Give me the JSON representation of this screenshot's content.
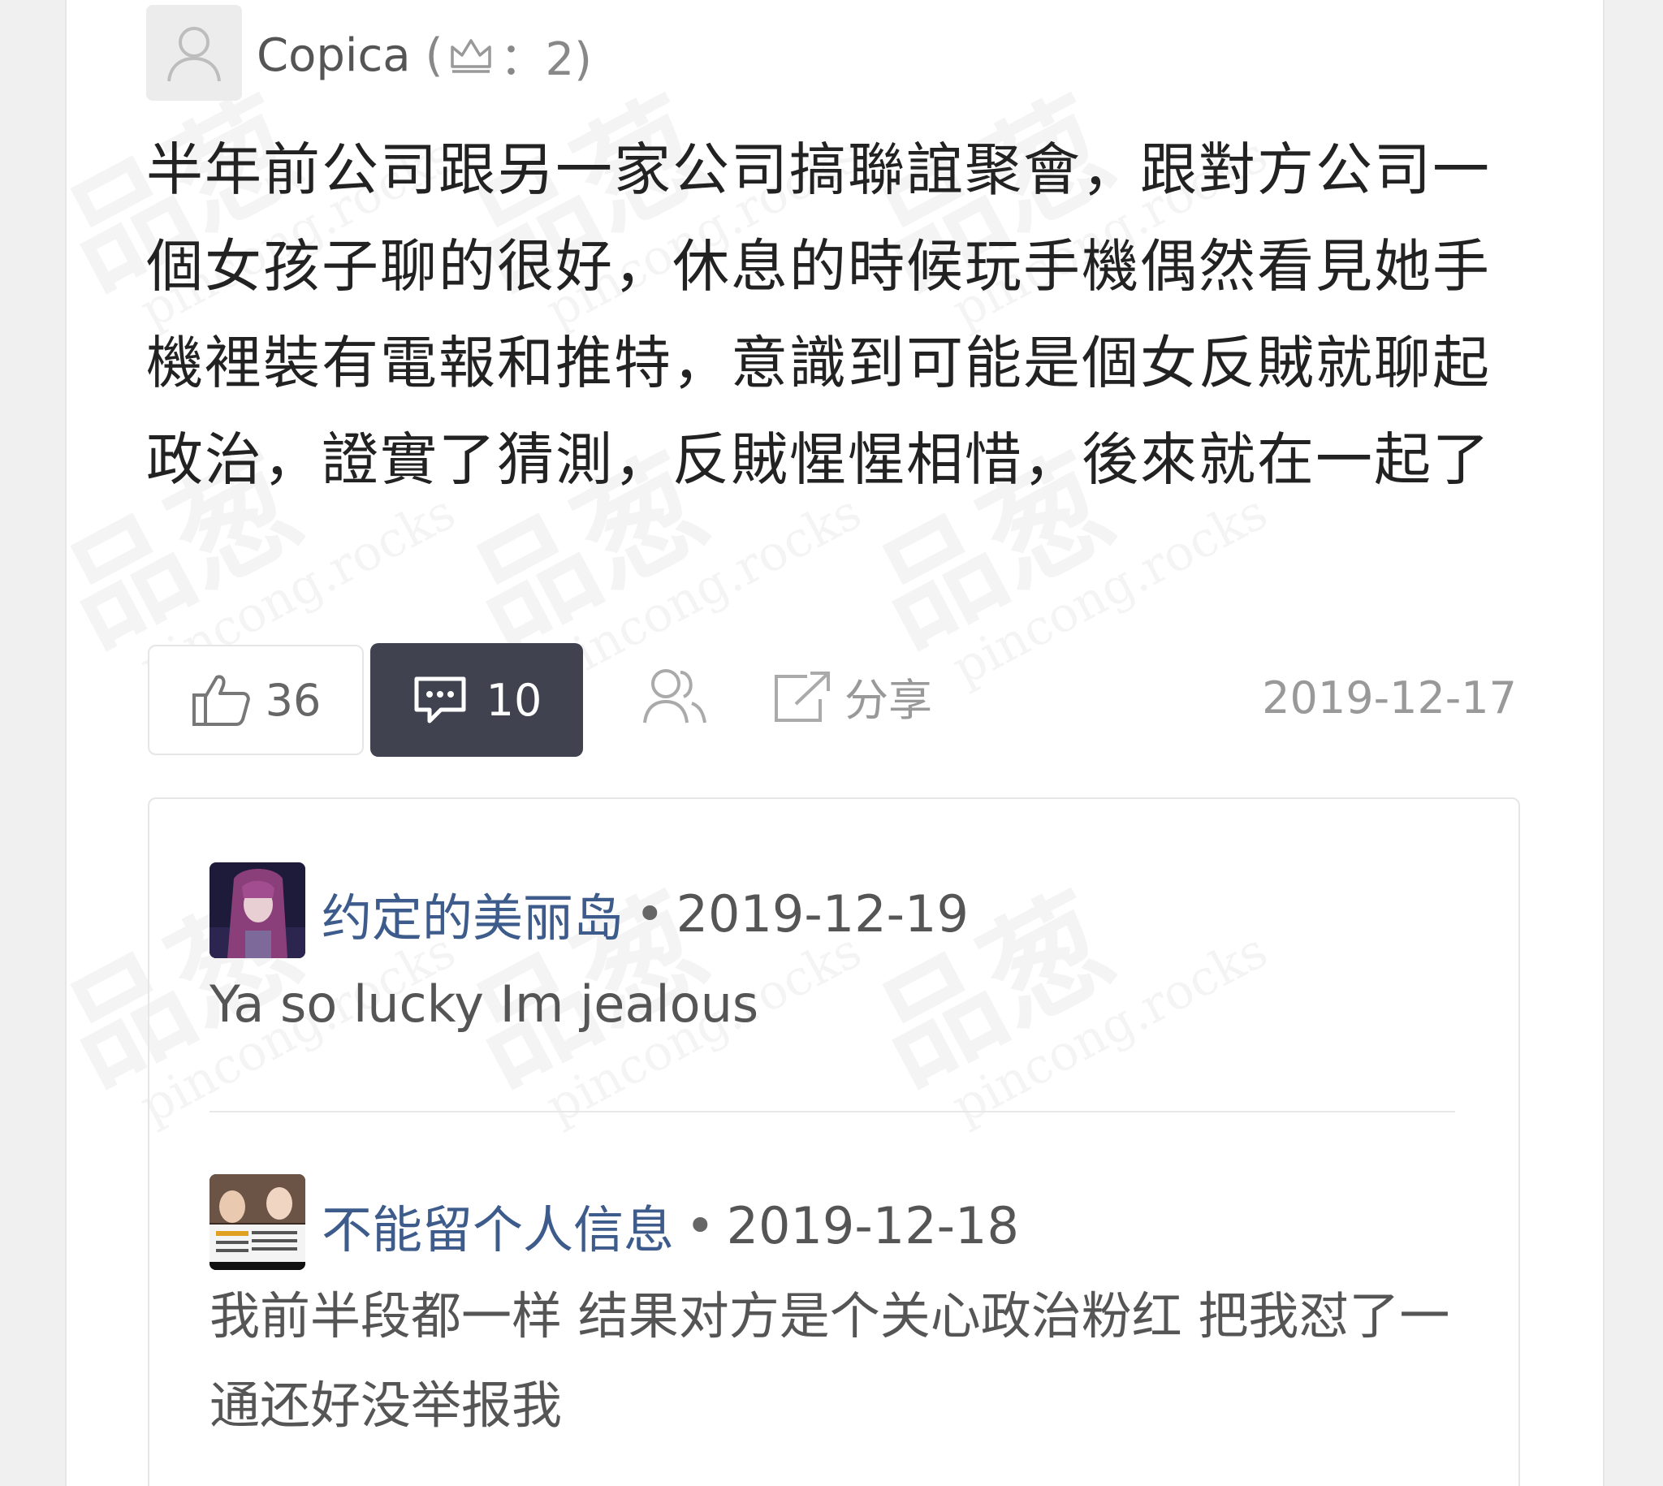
{
  "post": {
    "author": "Copica",
    "author_meta_open": "(",
    "author_meta_count": "：2)",
    "body": "半年前公司跟另一家公司搞聯誼聚會，跟對方公司一個女孩子聊的很好，休息的時候玩手機偶然看見她手機裡裝有電報和推特，意識到可能是個女反賊就聊起政治，證實了猜測，反賊惺惺相惜，後來就在一起了",
    "likes": "36",
    "comments": "10",
    "share_label": "分享",
    "date": "2019-12-17"
  },
  "comments": [
    {
      "user": "约定的美丽岛",
      "sep": "•",
      "date": "2019-12-19",
      "text": "Ya so lucky Im jealous"
    },
    {
      "user": "不能留个人信息",
      "sep": "•",
      "date": "2019-12-18",
      "text": "我前半段都一样 结果对方是个关心政治粉红 把我怼了一通还好没举报我"
    }
  ],
  "watermark": {
    "big": "品葱",
    "small": "pincong.rocks"
  },
  "colors": {
    "comment_button_bg": "#40434f",
    "username": "#3d5c8c",
    "body_text": "#222222"
  }
}
